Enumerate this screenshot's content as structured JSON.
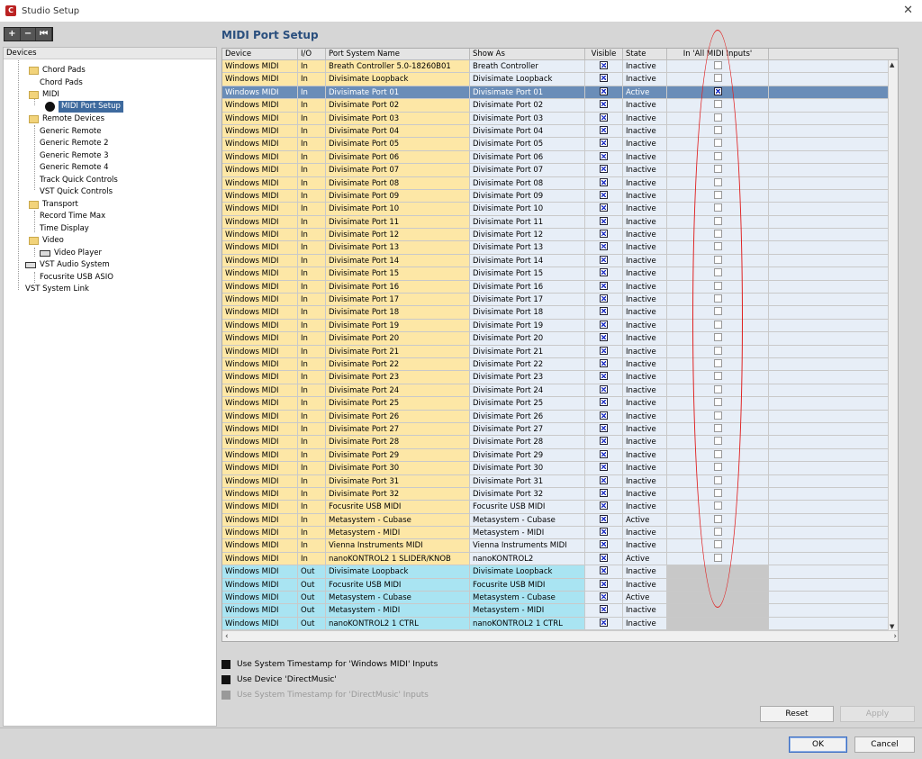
{
  "window": {
    "title": "Studio Setup"
  },
  "toolbar": {
    "add": "+",
    "remove": "−",
    "reset": "⏮"
  },
  "tree": {
    "header": "Devices",
    "items": [
      {
        "label": "Chord Pads",
        "icon": "folder"
      },
      {
        "label": "Chord Pads",
        "icon": "none"
      },
      {
        "label": "MIDI",
        "icon": "folder"
      },
      {
        "label": "MIDI Port Setup",
        "icon": "midi"
      },
      {
        "label": "Remote Devices",
        "icon": "folder"
      },
      {
        "label": "Generic Remote",
        "icon": "none"
      },
      {
        "label": "Generic Remote 2",
        "icon": "none"
      },
      {
        "label": "Generic Remote 3",
        "icon": "none"
      },
      {
        "label": "Generic Remote 4",
        "icon": "none"
      },
      {
        "label": "Track Quick Controls",
        "icon": "none"
      },
      {
        "label": "VST Quick Controls",
        "icon": "none"
      },
      {
        "label": "Transport",
        "icon": "folder"
      },
      {
        "label": "Record Time Max",
        "icon": "none"
      },
      {
        "label": "Time Display",
        "icon": "none"
      },
      {
        "label": "Video",
        "icon": "folder"
      },
      {
        "label": "Video Player",
        "icon": "small"
      },
      {
        "label": "VST Audio System",
        "icon": "small"
      },
      {
        "label": "Focusrite USB ASIO",
        "icon": "none"
      },
      {
        "label": "VST System Link",
        "icon": "none"
      }
    ]
  },
  "panel": {
    "title": "MIDI Port Setup"
  },
  "table": {
    "headers": [
      "Device",
      "I/O",
      "Port System Name",
      "Show As",
      "Visible",
      "State",
      "In 'All MIDI Inputs'"
    ],
    "rows": [
      {
        "device": "Windows MIDI",
        "io": "In",
        "port": "Breath Controller 5.0-18260B01",
        "show": "Breath Controller",
        "visible": true,
        "state": "Inactive",
        "all": false
      },
      {
        "device": "Windows MIDI",
        "io": "In",
        "port": "Divisimate Loopback",
        "show": "Divisimate Loopback",
        "visible": true,
        "state": "Inactive",
        "all": false
      },
      {
        "device": "Windows MIDI",
        "io": "In",
        "port": "Divisimate Port 01",
        "show": "Divisimate Port 01",
        "visible": true,
        "state": "Active",
        "all": true
      },
      {
        "device": "Windows MIDI",
        "io": "In",
        "port": "Divisimate Port 02",
        "show": "Divisimate Port 02",
        "visible": true,
        "state": "Inactive",
        "all": false
      },
      {
        "device": "Windows MIDI",
        "io": "In",
        "port": "Divisimate Port 03",
        "show": "Divisimate Port 03",
        "visible": true,
        "state": "Inactive",
        "all": false
      },
      {
        "device": "Windows MIDI",
        "io": "In",
        "port": "Divisimate Port 04",
        "show": "Divisimate Port 04",
        "visible": true,
        "state": "Inactive",
        "all": false
      },
      {
        "device": "Windows MIDI",
        "io": "In",
        "port": "Divisimate Port 05",
        "show": "Divisimate Port 05",
        "visible": true,
        "state": "Inactive",
        "all": false
      },
      {
        "device": "Windows MIDI",
        "io": "In",
        "port": "Divisimate Port 06",
        "show": "Divisimate Port 06",
        "visible": true,
        "state": "Inactive",
        "all": false
      },
      {
        "device": "Windows MIDI",
        "io": "In",
        "port": "Divisimate Port 07",
        "show": "Divisimate Port 07",
        "visible": true,
        "state": "Inactive",
        "all": false
      },
      {
        "device": "Windows MIDI",
        "io": "In",
        "port": "Divisimate Port 08",
        "show": "Divisimate Port 08",
        "visible": true,
        "state": "Inactive",
        "all": false
      },
      {
        "device": "Windows MIDI",
        "io": "In",
        "port": "Divisimate Port 09",
        "show": "Divisimate Port 09",
        "visible": true,
        "state": "Inactive",
        "all": false
      },
      {
        "device": "Windows MIDI",
        "io": "In",
        "port": "Divisimate Port 10",
        "show": "Divisimate Port 10",
        "visible": true,
        "state": "Inactive",
        "all": false
      },
      {
        "device": "Windows MIDI",
        "io": "In",
        "port": "Divisimate Port 11",
        "show": "Divisimate Port 11",
        "visible": true,
        "state": "Inactive",
        "all": false
      },
      {
        "device": "Windows MIDI",
        "io": "In",
        "port": "Divisimate Port 12",
        "show": "Divisimate Port 12",
        "visible": true,
        "state": "Inactive",
        "all": false
      },
      {
        "device": "Windows MIDI",
        "io": "In",
        "port": "Divisimate Port 13",
        "show": "Divisimate Port 13",
        "visible": true,
        "state": "Inactive",
        "all": false
      },
      {
        "device": "Windows MIDI",
        "io": "In",
        "port": "Divisimate Port 14",
        "show": "Divisimate Port 14",
        "visible": true,
        "state": "Inactive",
        "all": false
      },
      {
        "device": "Windows MIDI",
        "io": "In",
        "port": "Divisimate Port 15",
        "show": "Divisimate Port 15",
        "visible": true,
        "state": "Inactive",
        "all": false
      },
      {
        "device": "Windows MIDI",
        "io": "In",
        "port": "Divisimate Port 16",
        "show": "Divisimate Port 16",
        "visible": true,
        "state": "Inactive",
        "all": false
      },
      {
        "device": "Windows MIDI",
        "io": "In",
        "port": "Divisimate Port 17",
        "show": "Divisimate Port 17",
        "visible": true,
        "state": "Inactive",
        "all": false
      },
      {
        "device": "Windows MIDI",
        "io": "In",
        "port": "Divisimate Port 18",
        "show": "Divisimate Port 18",
        "visible": true,
        "state": "Inactive",
        "all": false
      },
      {
        "device": "Windows MIDI",
        "io": "In",
        "port": "Divisimate Port 19",
        "show": "Divisimate Port 19",
        "visible": true,
        "state": "Inactive",
        "all": false
      },
      {
        "device": "Windows MIDI",
        "io": "In",
        "port": "Divisimate Port 20",
        "show": "Divisimate Port 20",
        "visible": true,
        "state": "Inactive",
        "all": false
      },
      {
        "device": "Windows MIDI",
        "io": "In",
        "port": "Divisimate Port 21",
        "show": "Divisimate Port 21",
        "visible": true,
        "state": "Inactive",
        "all": false
      },
      {
        "device": "Windows MIDI",
        "io": "In",
        "port": "Divisimate Port 22",
        "show": "Divisimate Port 22",
        "visible": true,
        "state": "Inactive",
        "all": false
      },
      {
        "device": "Windows MIDI",
        "io": "In",
        "port": "Divisimate Port 23",
        "show": "Divisimate Port 23",
        "visible": true,
        "state": "Inactive",
        "all": false
      },
      {
        "device": "Windows MIDI",
        "io": "In",
        "port": "Divisimate Port 24",
        "show": "Divisimate Port 24",
        "visible": true,
        "state": "Inactive",
        "all": false
      },
      {
        "device": "Windows MIDI",
        "io": "In",
        "port": "Divisimate Port 25",
        "show": "Divisimate Port 25",
        "visible": true,
        "state": "Inactive",
        "all": false
      },
      {
        "device": "Windows MIDI",
        "io": "In",
        "port": "Divisimate Port 26",
        "show": "Divisimate Port 26",
        "visible": true,
        "state": "Inactive",
        "all": false
      },
      {
        "device": "Windows MIDI",
        "io": "In",
        "port": "Divisimate Port 27",
        "show": "Divisimate Port 27",
        "visible": true,
        "state": "Inactive",
        "all": false
      },
      {
        "device": "Windows MIDI",
        "io": "In",
        "port": "Divisimate Port 28",
        "show": "Divisimate Port 28",
        "visible": true,
        "state": "Inactive",
        "all": false
      },
      {
        "device": "Windows MIDI",
        "io": "In",
        "port": "Divisimate Port 29",
        "show": "Divisimate Port 29",
        "visible": true,
        "state": "Inactive",
        "all": false
      },
      {
        "device": "Windows MIDI",
        "io": "In",
        "port": "Divisimate Port 30",
        "show": "Divisimate Port 30",
        "visible": true,
        "state": "Inactive",
        "all": false
      },
      {
        "device": "Windows MIDI",
        "io": "In",
        "port": "Divisimate Port 31",
        "show": "Divisimate Port 31",
        "visible": true,
        "state": "Inactive",
        "all": false
      },
      {
        "device": "Windows MIDI",
        "io": "In",
        "port": "Divisimate Port 32",
        "show": "Divisimate Port 32",
        "visible": true,
        "state": "Inactive",
        "all": false
      },
      {
        "device": "Windows MIDI",
        "io": "In",
        "port": "Focusrite USB MIDI",
        "show": "Focusrite USB MIDI",
        "visible": true,
        "state": "Inactive",
        "all": false
      },
      {
        "device": "Windows MIDI",
        "io": "In",
        "port": "Metasystem - Cubase",
        "show": "Metasystem - Cubase",
        "visible": true,
        "state": "Active",
        "all": false
      },
      {
        "device": "Windows MIDI",
        "io": "In",
        "port": "Metasystem - MIDI",
        "show": "Metasystem - MIDI",
        "visible": true,
        "state": "Inactive",
        "all": false
      },
      {
        "device": "Windows MIDI",
        "io": "In",
        "port": "Vienna Instruments MIDI",
        "show": "Vienna Instruments MIDI",
        "visible": true,
        "state": "Inactive",
        "all": false
      },
      {
        "device": "Windows MIDI",
        "io": "In",
        "port": "nanoKONTROL2 1 SLIDER/KNOB",
        "show": "nanoKONTROL2",
        "visible": true,
        "state": "Active",
        "all": false
      },
      {
        "device": "Windows MIDI",
        "io": "Out",
        "port": "Divisimate Loopback",
        "show": "Divisimate Loopback",
        "visible": true,
        "state": "Inactive",
        "all": null
      },
      {
        "device": "Windows MIDI",
        "io": "Out",
        "port": "Focusrite USB MIDI",
        "show": "Focusrite USB MIDI",
        "visible": true,
        "state": "Inactive",
        "all": null
      },
      {
        "device": "Windows MIDI",
        "io": "Out",
        "port": "Metasystem - Cubase",
        "show": "Metasystem - Cubase",
        "visible": true,
        "state": "Active",
        "all": null
      },
      {
        "device": "Windows MIDI",
        "io": "Out",
        "port": "Metasystem - MIDI",
        "show": "Metasystem - MIDI",
        "visible": true,
        "state": "Inactive",
        "all": null
      },
      {
        "device": "Windows MIDI",
        "io": "Out",
        "port": "nanoKONTROL2 1 CTRL",
        "show": "nanoKONTROL2 1 CTRL",
        "visible": true,
        "state": "Inactive",
        "all": null
      }
    ]
  },
  "options": [
    {
      "label": "Use System Timestamp for 'Windows MIDI' Inputs",
      "enabled": true
    },
    {
      "label": "Use Device 'DirectMusic'",
      "enabled": true
    },
    {
      "label": "Use System Timestamp for 'DirectMusic' Inputs",
      "enabled": false
    }
  ],
  "buttons": {
    "reset": "Reset",
    "apply": "Apply",
    "ok": "OK",
    "cancel": "Cancel"
  },
  "colors": {
    "in_row": "#fde7a6",
    "out_row": "#a9e4f2",
    "selected_row": "#6a8db8",
    "title": "#2a4f7e",
    "annotation": "#e02020"
  }
}
